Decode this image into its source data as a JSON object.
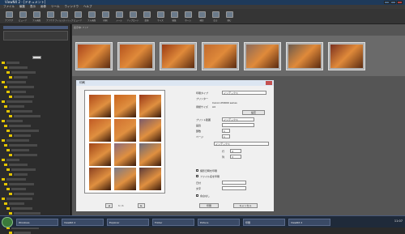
{
  "window": {
    "title": "ViewNX 2 - [ドキュメント]"
  },
  "menu": [
    "ファイル",
    "編集",
    "表示",
    "画像",
    "ツール",
    "ウィンドウ",
    "ヘルプ"
  ],
  "toolbar": [
    "ブラウザ",
    "ビューア",
    "フル画面",
    "ブラウザ",
    "フィルムストリップ",
    "ビューア",
    "フル画面",
    "印刷",
    "メール",
    "アップロード",
    "変換",
    "サイズ",
    "編集",
    "ホーム",
    "補正",
    "戻る",
    "進む"
  ],
  "thumbnails": {
    "header": "表示中: 7 / 7"
  },
  "dialog": {
    "title": "印刷",
    "printer_section": "印刷タイプ",
    "printer_label": "プリンター",
    "printer_value": "Canon iP4600 series",
    "paper_label": "用紙サイズ",
    "paper_value": "A4",
    "settings_button": "設定",
    "layout_label": "プリント範囲",
    "layout_value": "インデックス",
    "quality_label": "画質",
    "quality_value": "",
    "copies_label": "部数",
    "copies_value": "1",
    "page_label": "ページ",
    "page_value": "1",
    "rows_label": "行",
    "rows_value": "4",
    "cols_label": "列",
    "cols_value": "3",
    "checks": [
      "撮影日時を印刷",
      "ファイル名を印刷",
      "余白なし"
    ],
    "date_label": "日付",
    "date_value": "",
    "text_label": "文字",
    "text_value": "",
    "print_button": "印刷",
    "cancel_button": "キャンセル",
    "page_nav": "1 / 1"
  },
  "taskbar": {
    "items": [
      "Windows",
      "ViewNX 2",
      "Explorer",
      "Folder",
      "Picture",
      "印刷",
      "ViewNX 2"
    ],
    "clock": "11:07"
  },
  "colors": {
    "accent": "#1e3a5a",
    "folder": "#e2c400",
    "autumn": "#b04a1a"
  }
}
